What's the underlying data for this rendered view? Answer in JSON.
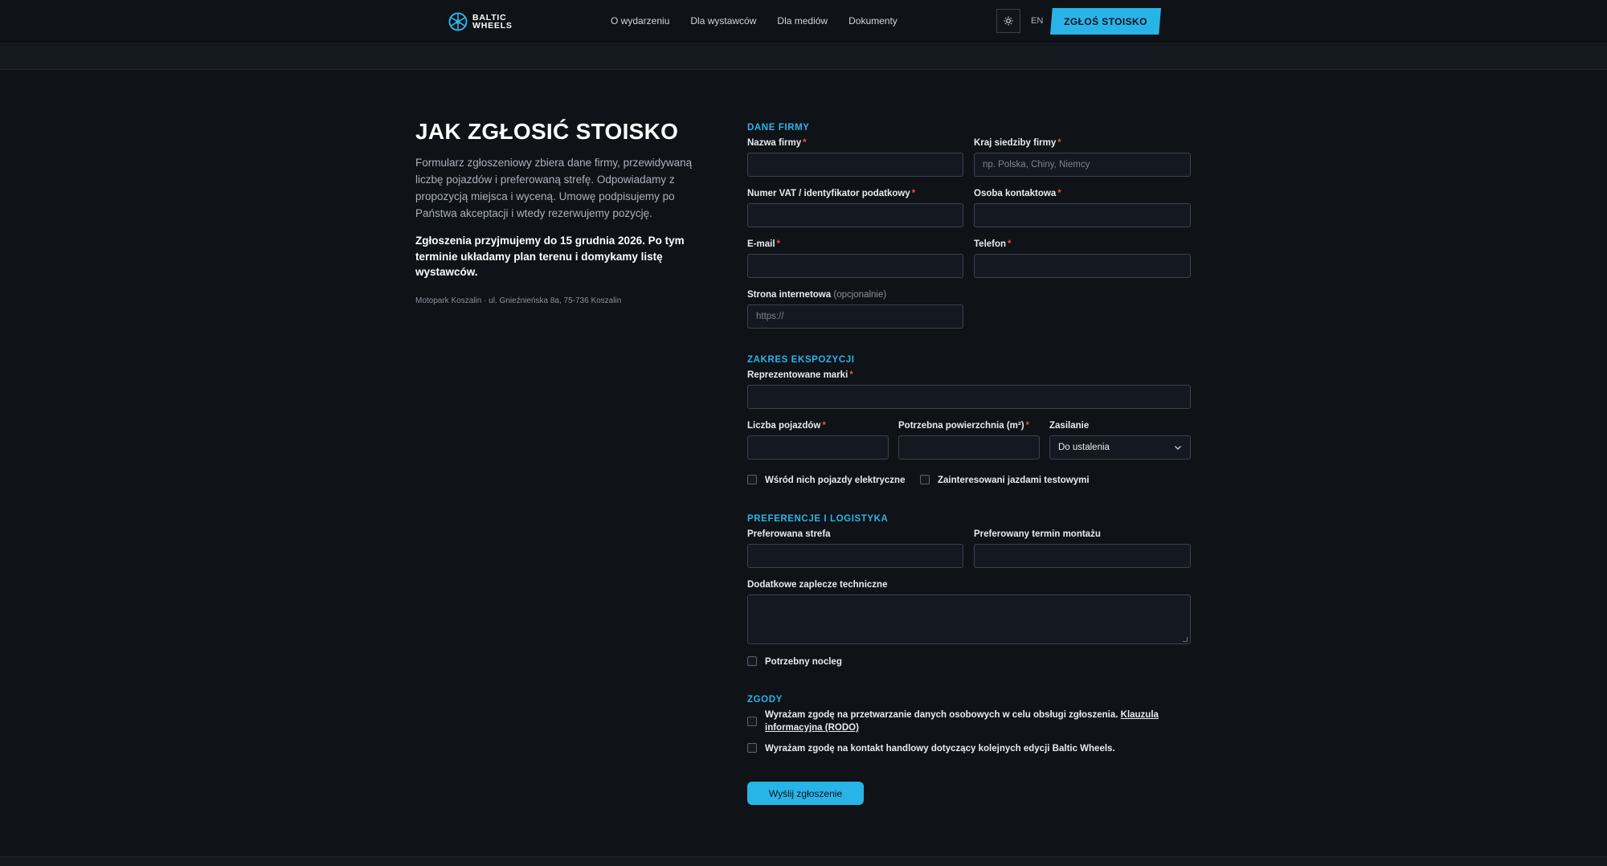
{
  "header": {
    "logo_line1": "BALTIC",
    "logo_line2": "WHEELS",
    "nav": [
      "O wydarzeniu",
      "Dla wystawców",
      "Dla mediów",
      "Dokumenty"
    ],
    "theme_icon": "sun-icon",
    "lang": "EN",
    "cta": "ZGŁOŚ STOISKO"
  },
  "intro": {
    "title": "JAK ZGŁOSIĆ STOISKO",
    "lead": "Formularz zgłoszeniowy zbiera dane firmy, przewidywaną liczbę pojazdów i preferowaną strefę. Odpowiadamy z propozycją miejsca i wyceną. Umowę podpisujemy po Państwa akceptacji i wtedy rezerwujemy pozycję.",
    "deadline": "Zgłoszenia przyjmujemy do 15 grudnia 2026. Po tym terminie układamy plan terenu i domykamy listę wystawców.",
    "address": "Motopark Koszalin · ul. Gnieźnieńska 8a, 75-736 Koszalin"
  },
  "form": {
    "company": {
      "title": "DANE FIRMY",
      "name_label": "Nazwa firmy",
      "country_label": "Kraj siedziby firmy",
      "country_placeholder": "np. Polska, Chiny, Niemcy",
      "vat_label": "Numer VAT / identyfikator podatkowy",
      "contact_label": "Osoba kontaktowa",
      "email_label": "E-mail",
      "phone_label": "Telefon",
      "website_label": "Strona internetowa",
      "website_optional": "(opcjonalnie)",
      "website_placeholder": "https://"
    },
    "exhibit": {
      "title": "ZAKRES EKSPOZYCJI",
      "brands_label": "Reprezentowane marki",
      "vehicles_label": "Liczba pojazdów",
      "area_label": "Potrzebna powierzchnia (m²)",
      "power_label": "Zasilanie",
      "power_value": "Do ustalenia",
      "ev_label": "Wśród nich pojazdy elektryczne",
      "test_drive_label": "Zainteresowani jazdami testowymi"
    },
    "logistics": {
      "title": "PREFERENCJE I LOGISTYKA",
      "zone_label": "Preferowana strefa",
      "mount_label": "Preferowany termin montażu",
      "tech_label": "Dodatkowe zaplecze techniczne",
      "lodging_label": "Potrzebny nocleg"
    },
    "consents": {
      "title": "ZGODY",
      "gdpr_text": "Wyrażam zgodę na przetwarzanie danych osobowych w celu obsługi zgłoszenia.",
      "gdpr_link": "Klauzula informacyjna (RODO)",
      "marketing_text": "Wyrażam zgodę na kontakt handlowy dotyczący kolejnych edycji Baltic Wheels."
    },
    "submit": "Wyślij zgłoszenie",
    "required_mark": "*"
  },
  "colors": {
    "accent": "#29b4e8",
    "background": "#0f1217",
    "required": "#ef4c4c"
  }
}
